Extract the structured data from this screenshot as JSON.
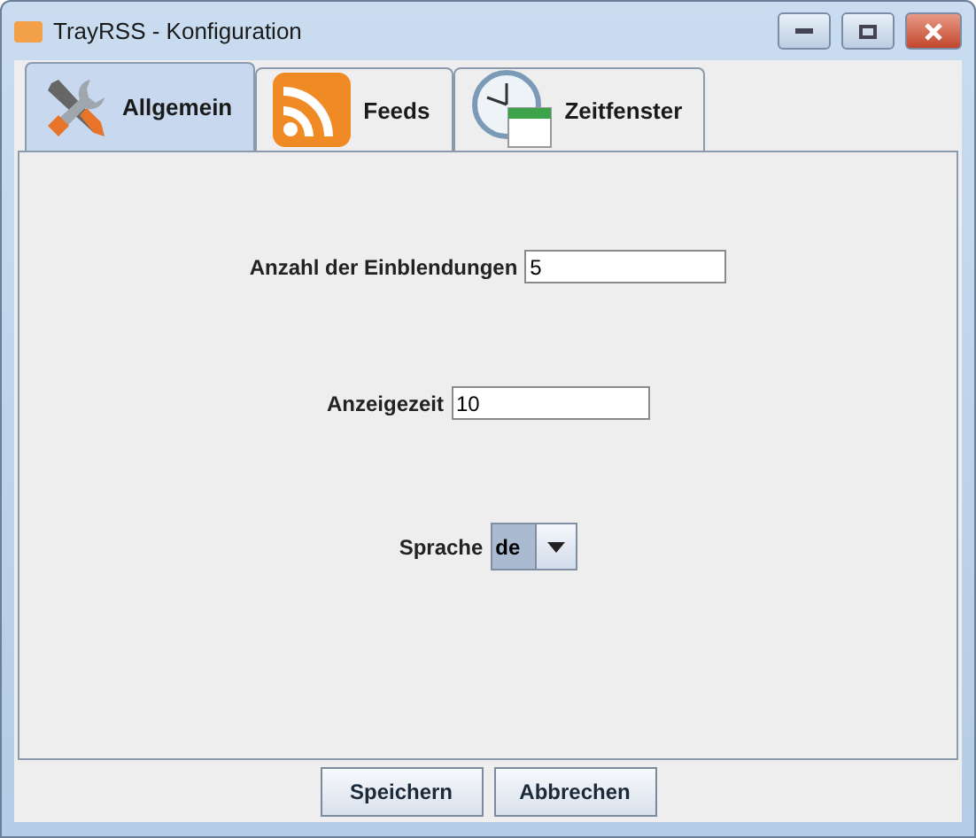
{
  "window": {
    "title": "TrayRSS - Konfiguration"
  },
  "tabs": [
    {
      "label": "Allgemein",
      "selected": true
    },
    {
      "label": "Feeds",
      "selected": false
    },
    {
      "label": "Zeitfenster",
      "selected": false
    }
  ],
  "fields": [
    {
      "kind": "text",
      "label": "Anzahl der Einblendungen",
      "value": "5"
    },
    {
      "kind": "text",
      "label": "Anzeigezeit",
      "value": "10"
    },
    {
      "kind": "select",
      "label": "Sprache",
      "value": "de"
    }
  ],
  "buttons": [
    "Speichern",
    "Abbrechen"
  ]
}
